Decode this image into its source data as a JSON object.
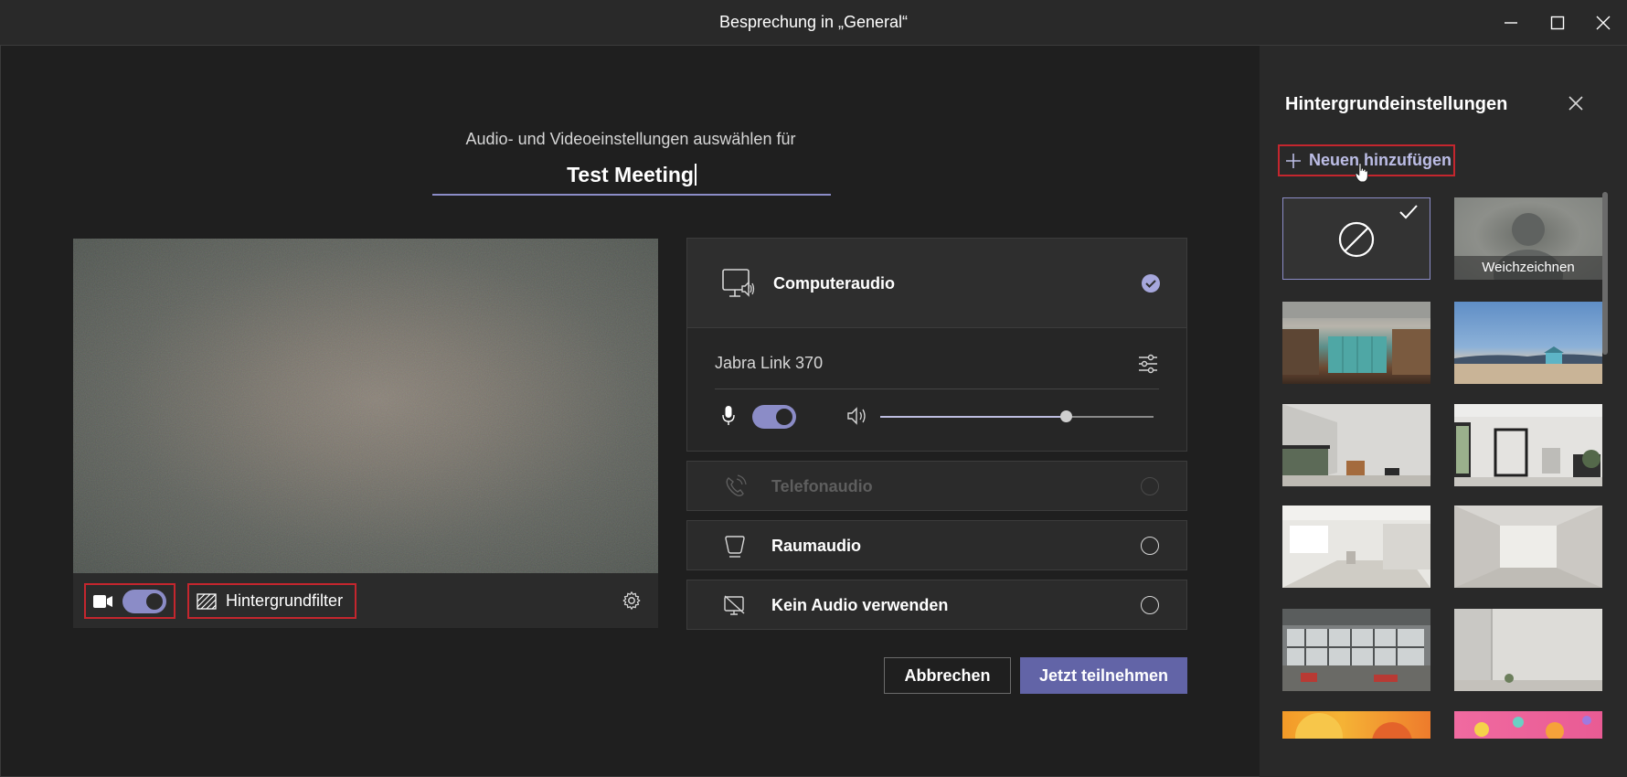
{
  "window": {
    "title": "Besprechung in „General“"
  },
  "prejoin": {
    "subtitle": "Audio- und Videoeinstellungen auswählen für",
    "meeting_name": "Test Meeting"
  },
  "video_controls": {
    "camera_on": true,
    "background_filter_label": "Hintergrundfilter"
  },
  "audio": {
    "computer_audio": {
      "label": "Computeraudio",
      "selected": true
    },
    "device": {
      "name": "Jabra Link 370",
      "mic_on": true,
      "volume": 0.68
    },
    "options": [
      {
        "label": "Telefonaudio",
        "disabled": true
      },
      {
        "label": "Raumaudio",
        "disabled": false
      },
      {
        "label": "Kein Audio verwenden",
        "disabled": false
      }
    ]
  },
  "actions": {
    "cancel": "Abbrechen",
    "join": "Jetzt teilnehmen"
  },
  "background_panel": {
    "title": "Hintergrundeinstellungen",
    "add_new": "Neuen hinzufügen",
    "blur_label": "Weichzeichnen",
    "selected": "none"
  },
  "colors": {
    "accent": "#6264a7",
    "accent_light": "#8b8cc7",
    "highlight": "#c4262e",
    "background": "#1f1f1f"
  }
}
